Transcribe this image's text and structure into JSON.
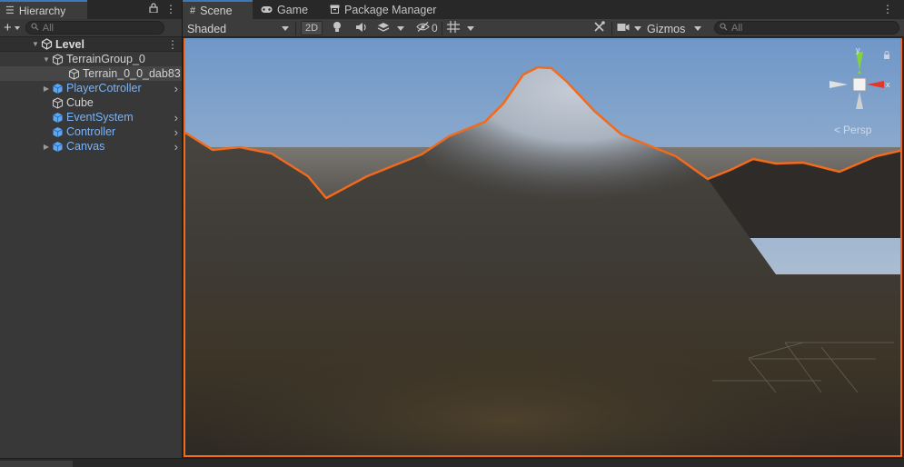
{
  "hierarchy": {
    "tab_label": "Hierarchy",
    "search_placeholder": "All",
    "scene_name": "Level",
    "items": [
      {
        "label": "TerrainGroup_0",
        "color": "white"
      },
      {
        "label": "Terrain_0_0_dab83",
        "color": "white"
      },
      {
        "label": "PlayerCotroller",
        "color": "blue"
      },
      {
        "label": "Cube",
        "color": "white"
      },
      {
        "label": "EventSystem",
        "color": "blue"
      },
      {
        "label": "Controller",
        "color": "blue"
      },
      {
        "label": "Canvas",
        "color": "blue"
      }
    ]
  },
  "scene_tabs": [
    {
      "label": "Scene"
    },
    {
      "label": "Game"
    },
    {
      "label": "Package Manager"
    }
  ],
  "scene_toolbar": {
    "shading_mode": "Shaded",
    "two_d_label": "2D",
    "hidden_count": "0",
    "gizmos_label": "Gizmos",
    "search_placeholder": "All"
  },
  "orientation_gizmo": {
    "y_label": "y",
    "x_label": "x",
    "projection": "Persp"
  },
  "colors": {
    "selection_outline": "#f26a1b",
    "prefab_blue": "#7cb3f2",
    "active_tab_accent": "#3a79bb"
  }
}
